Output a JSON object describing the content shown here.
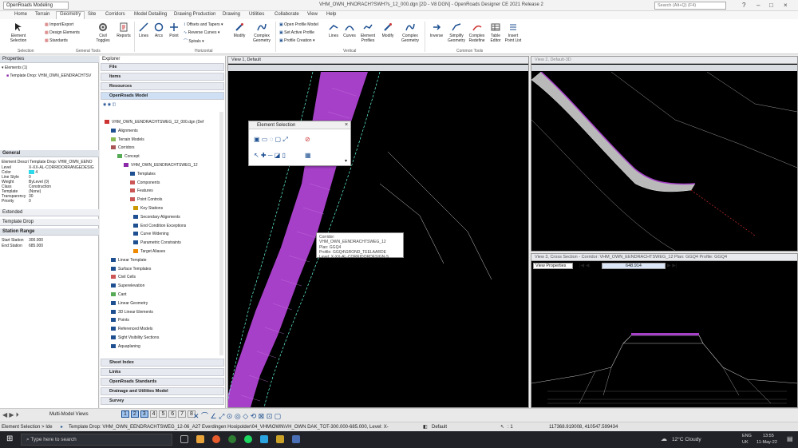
{
  "titlebar": {
    "workflow": "OpenRoads Modeling",
    "title": "VHM_OWN_HNORACH?SWH?s_12_000.dgn [2D - V8 DGN] - OpenRoads Designer CE 2021 Release 2",
    "search_placeholder": "Search (Alt+Q) (F4)"
  },
  "tabs": [
    "Home",
    "Terrain",
    "Geometry",
    "Site",
    "Corridors",
    "Model Detailing",
    "Drawing Production",
    "Drawing",
    "Utilities",
    "Collaborate",
    "View",
    "Help"
  ],
  "active_tab": "Geometry",
  "ribbon": {
    "element_selection": "Element Selection",
    "import_export": "Import/Export",
    "design_elements": "Design Elements",
    "standards": "Standards",
    "civil_toggles": "Civil Toggles",
    "reports": "Reports",
    "lines": "Lines",
    "arcs": "Arcs",
    "point": "Point",
    "offsets_tapers": "Offsets and Tapers",
    "reverse_curves": "Reverse Curves",
    "spirals": "Spirals",
    "modify": "Modify",
    "complex_geometry": "Complex Geometry",
    "open_profile_model": "Open Profile Model",
    "set_active_profile": "Set Active Profile",
    "profile_creation": "Profile Creation",
    "lines_v": "Lines",
    "curves_v": "Curves",
    "element_profiles": "Element Profiles",
    "modify_v": "Modify",
    "complex_geometry_v": "Complex Geometry",
    "inverse": "Inverse",
    "simplify_geometry": "Simplify Geometry",
    "complex_redefine": "Complex Redefine",
    "table_editor": "Table Editor",
    "insert_point_list": "Insert Point List",
    "groups": {
      "selection": "Selection",
      "general_tools": "General Tools",
      "horizontal": "Horizontal",
      "vertical": "Vertical",
      "common_tools": "Common Tools"
    }
  },
  "properties": {
    "title": "Properties",
    "elements": "Elements (1)",
    "item": "Template Drop: VHM_OWN_EENDRACHTSV",
    "general_header": "General",
    "element_descr": "Element Descri Template Drop: VHM_OWN_EENO",
    "rows": [
      {
        "label": "Level",
        "value": "X-XX-AL-CORRIDORRANGEDESIG"
      },
      {
        "label": "Color",
        "value": "4"
      },
      {
        "label": "Line Style",
        "value": "0"
      },
      {
        "label": "Weight",
        "value": "ByLevel (0)"
      },
      {
        "label": "Class",
        "value": "Construction"
      },
      {
        "label": "Template",
        "value": "(None)"
      },
      {
        "label": "Transparency",
        "value": "30"
      },
      {
        "label": "Priority",
        "value": "0"
      }
    ],
    "extended": "Extended",
    "template_drop": "Template Drop",
    "station_range": "Station Range",
    "start_station_label": "Start Station",
    "start_station": "300.000",
    "end_station_label": "End Station",
    "end_station": "685.000"
  },
  "explorer": {
    "title": "Explorer",
    "file": "File",
    "items": "Items",
    "resources": "Resources",
    "openroads_model": "OpenRoads Model",
    "tree": [
      {
        "label": "VHM_OWN_EENDRACHTSWEG_12_000.dgn (Def"
      },
      {
        "label": "Alignments"
      },
      {
        "label": "Terrain Models"
      },
      {
        "label": "Corridors"
      },
      {
        "label": "Concept"
      },
      {
        "label": "VHM_OWN_EENDRACHTSWEG_12"
      },
      {
        "label": "Templates"
      },
      {
        "label": "Components"
      },
      {
        "label": "Features"
      },
      {
        "label": "Point Controls"
      },
      {
        "label": "Key Stations"
      },
      {
        "label": "Secondary Alignments"
      },
      {
        "label": "End Condition Exceptions"
      },
      {
        "label": "Curve Widening"
      },
      {
        "label": "Parametric Constraints"
      },
      {
        "label": "Target Aliases"
      },
      {
        "label": "Linear Template"
      },
      {
        "label": "Surface Templates"
      },
      {
        "label": "Civil Cells"
      },
      {
        "label": "Superelevation"
      },
      {
        "label": "Cant"
      },
      {
        "label": "Linear Geometry"
      },
      {
        "label": "3D Linear Elements"
      },
      {
        "label": "Points"
      },
      {
        "label": "Referenced Models"
      },
      {
        "label": "Sight Visibility Sections"
      },
      {
        "label": "Aquaplaning"
      }
    ],
    "bottom": [
      "Sheet Index",
      "Links",
      "OpenRoads Standards",
      "Drainage and Utilities Model",
      "Survey"
    ]
  },
  "views": {
    "view1": "View 1, Default",
    "view2": "View 2, Default-3D",
    "view3": "View 3, Cross Section - Corridor: VHM_OWN_EENDRACHTSWEG_12 Plan: GGQ4 Profile: GGQ4",
    "view_properties": "View Properties",
    "station": "648.914"
  },
  "element_selection_dialog": {
    "title": "Element Selection"
  },
  "tooltip": {
    "lines": [
      "Corridor: VHM_OWN_EENDRACHTSWEG_12",
      "Plan: GGQ4",
      "Profile: GGQ4\\GROND_TEELAARDE",
      "Level: X-XX-AL-CORRIDORDESIGN-S"
    ]
  },
  "bottom_toolbar": {
    "multi_model": "Multi-Model Views",
    "views": [
      "1",
      "2",
      "3",
      "4",
      "5",
      "6",
      "7",
      "8"
    ]
  },
  "status": {
    "left": "Element Selection > Ide",
    "message": "Template Drop: VHM_OWN_EENDRACHTSWEG_12-06_A27 Everdingen Hooipolder\\04_VHM\\OWN\\VH_OWN DAK_TOT-300.000-685.000, Level: X-",
    "default": "Default",
    "view_num": ": 1",
    "coords": "117368.919008, 410547.599434"
  },
  "taskbar": {
    "search": "Type here to search",
    "weather": "12°C  Cloudy",
    "lang": "ENG",
    "region": "UK",
    "time": "13:55",
    "date": "11-May-22"
  },
  "colors": {
    "corridor": "#a640c8",
    "accent": "#1d4f91",
    "status_bg": "#e4e4e4"
  }
}
